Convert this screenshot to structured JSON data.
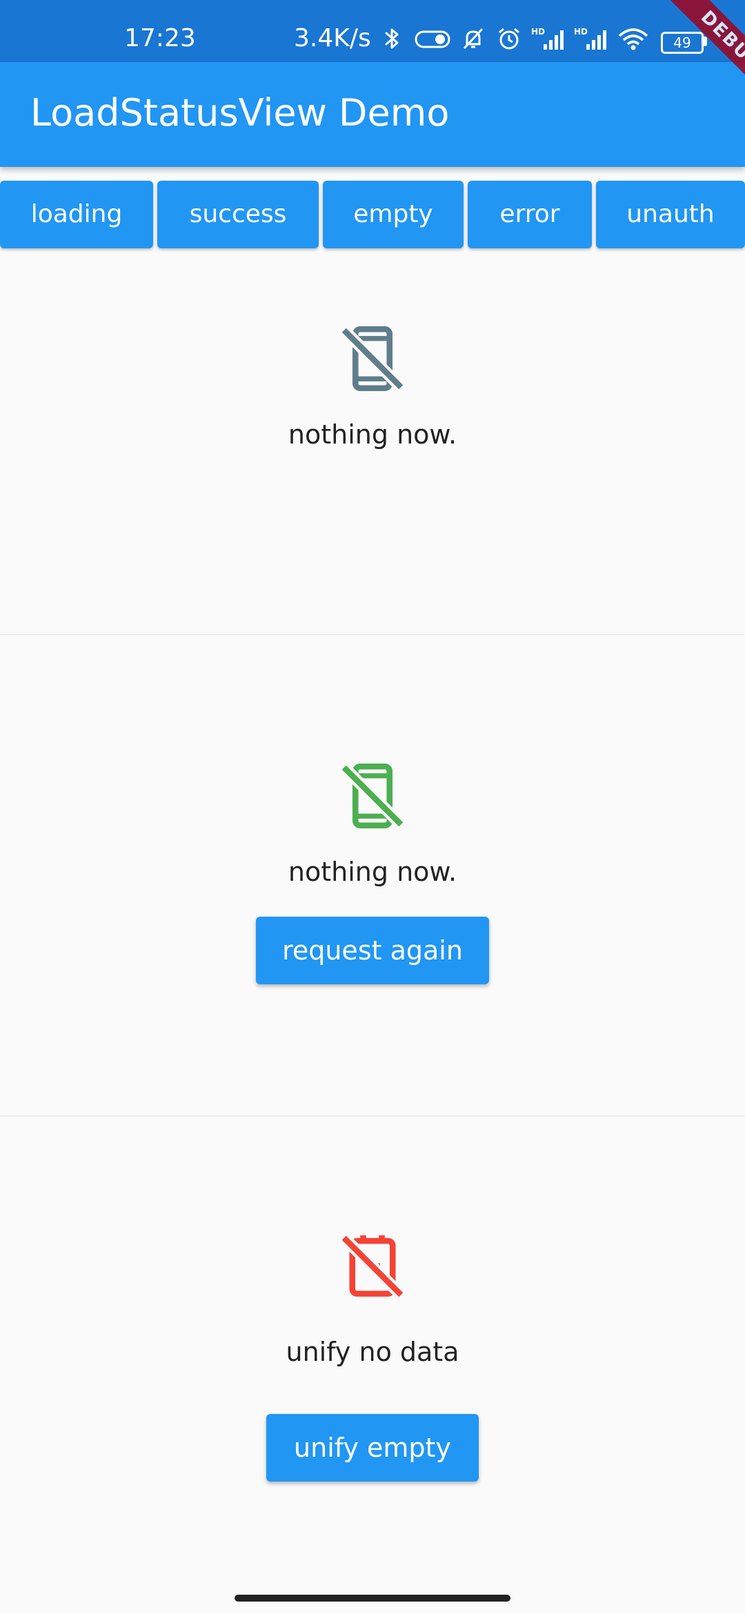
{
  "status_bar": {
    "time": "17:23",
    "network_speed": "3.4K/s",
    "battery_level": "49",
    "icons": [
      "bluetooth-icon",
      "toggle-icon",
      "mute-icon",
      "alarm-icon",
      "signal-hd-icon",
      "signal-hd-icon",
      "wifi-icon"
    ]
  },
  "debug_banner": "DEBUG",
  "app_bar": {
    "title": "LoadStatusView Demo",
    "color": "#2196f3"
  },
  "status_buttons": [
    {
      "label": "loading"
    },
    {
      "label": "success"
    },
    {
      "label": "empty"
    },
    {
      "label": "error"
    },
    {
      "label": "unauth"
    }
  ],
  "sections": [
    {
      "icon": "no-phone-icon",
      "icon_color": "#607d8b",
      "message": "nothing now."
    },
    {
      "icon": "no-phone-icon",
      "icon_color": "#4caf50",
      "message": "nothing now.",
      "button_label": "request again"
    },
    {
      "icon": "no-battery-icon",
      "icon_color": "#f44336",
      "message": "unify no data",
      "button_label": "unify empty"
    }
  ]
}
